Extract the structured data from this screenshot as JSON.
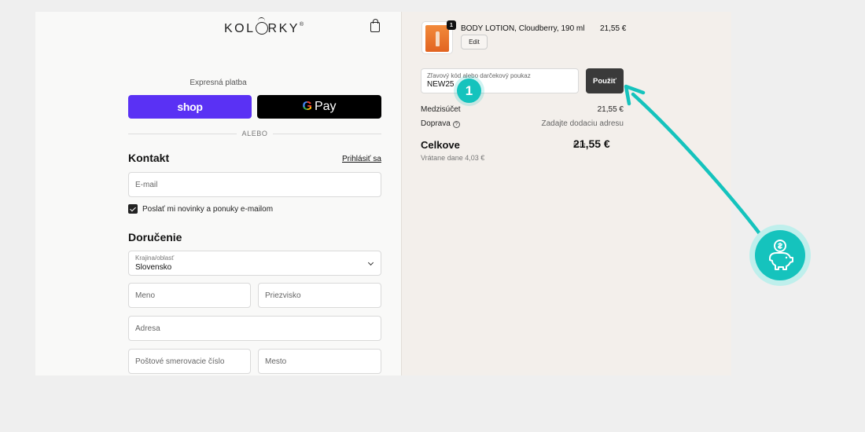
{
  "header": {
    "logo": "KOLÓRKY",
    "logo_left": "KOL",
    "logo_right": "RKY",
    "logo_reg": "®"
  },
  "express": {
    "label": "Expresná platba",
    "shop_label": "shop",
    "gpay_g": "G",
    "gpay_label": "Pay",
    "or_label": "ALEBO"
  },
  "contact": {
    "title": "Kontakt",
    "login_link": "Prihlásiť sa",
    "email_placeholder": "E-mail",
    "newsletter_label": "Poslať mi novinky a ponuky e-mailom",
    "newsletter_checked": true
  },
  "delivery": {
    "title": "Doručenie",
    "country_label": "Krajina/oblasť",
    "country_value": "Slovensko",
    "first_name_placeholder": "Meno",
    "last_name_placeholder": "Priezvisko",
    "address_placeholder": "Adresa",
    "postal_placeholder": "Poštové smerovacie číslo",
    "city_placeholder": "Mesto"
  },
  "cart": {
    "item": {
      "quantity": "1",
      "name": "BODY LOTION, Cloudberry, 190 ml",
      "price": "21,55 €",
      "edit_label": "Edit"
    },
    "discount": {
      "label": "Zľavový kód alebo darčekový poukaz",
      "value": "NEW25",
      "apply_label": "Použiť"
    },
    "subtotal": {
      "label": "Medzisúčet",
      "value": "21,55 €"
    },
    "shipping": {
      "label": "Doprava",
      "help": "?",
      "value": "Zadajte dodaciu adresu"
    },
    "total": {
      "label": "Celkove",
      "currency": "EUR",
      "value": "21,55 €"
    },
    "tax": "Vrátane dane 4,03 €"
  },
  "annotation": {
    "marker": "1",
    "colors": {
      "accent": "#15c3bd"
    }
  }
}
